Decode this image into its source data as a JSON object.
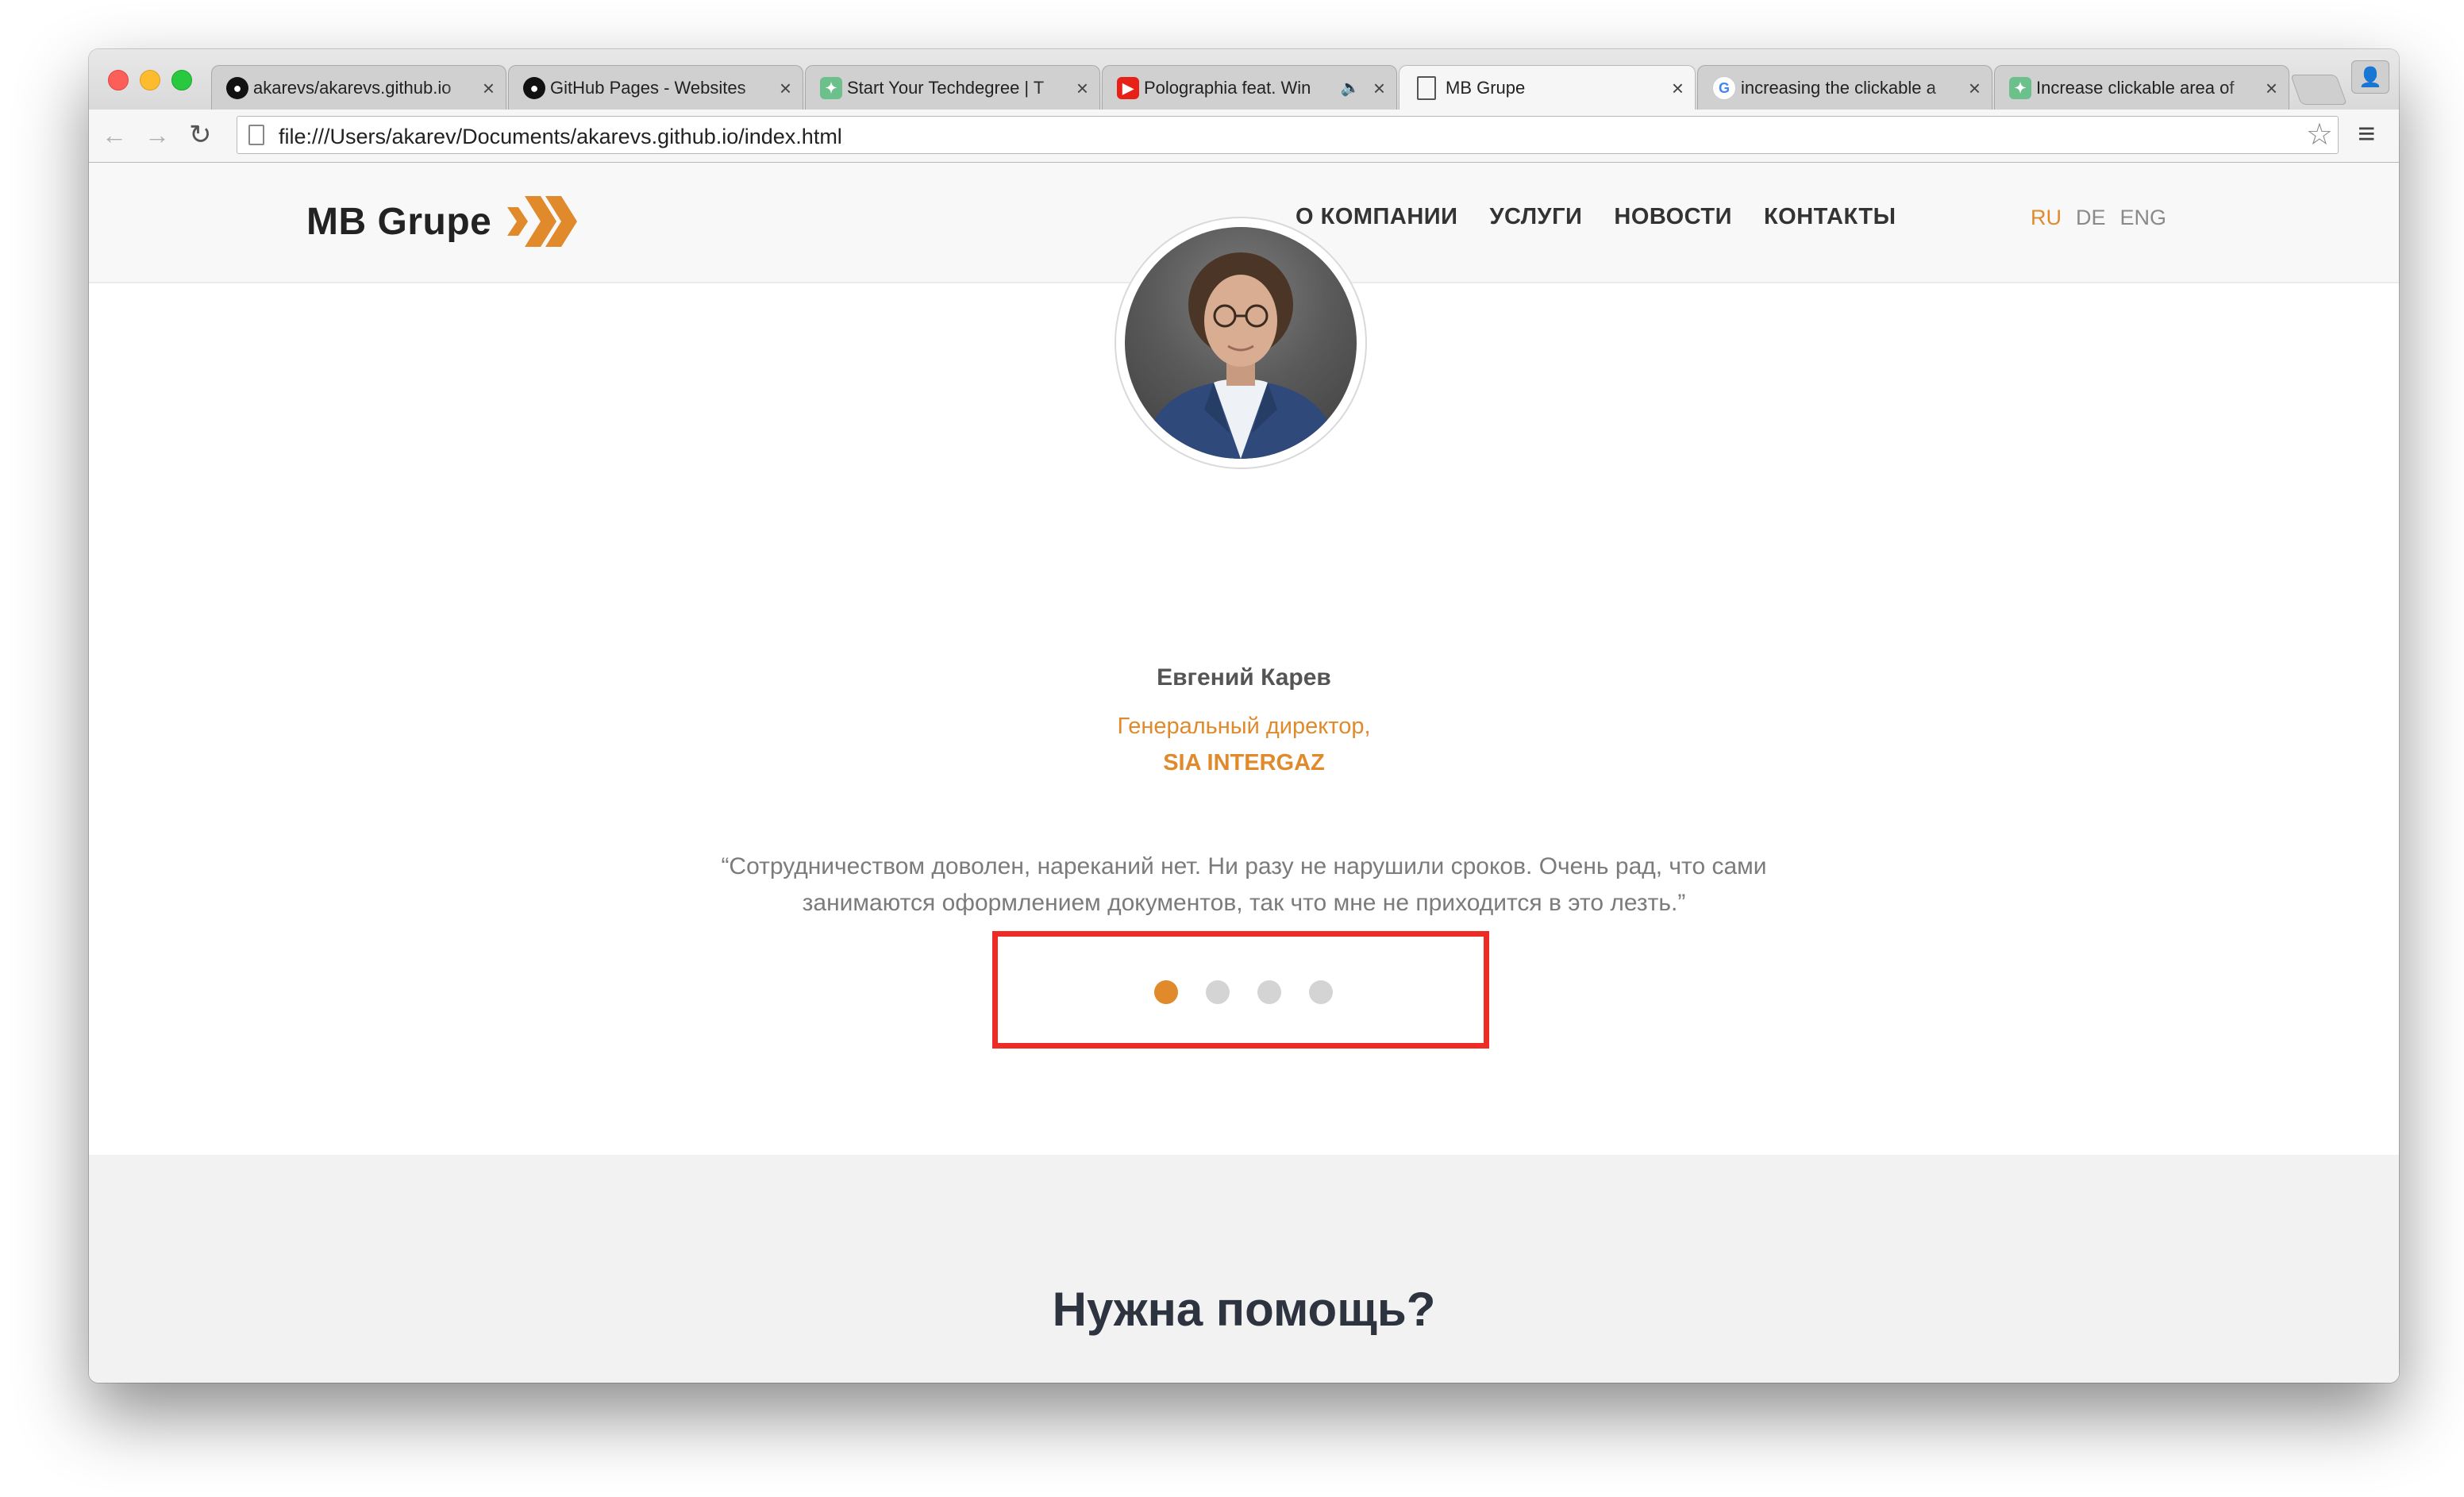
{
  "browser": {
    "tabs": [
      {
        "title": "akarevs/akarevs.github.io",
        "favicon": "github-icon"
      },
      {
        "title": "GitHub Pages - Websites",
        "favicon": "github-icon"
      },
      {
        "title": "Start Your Techdegree | T",
        "favicon": "treehouse-icon"
      },
      {
        "title": "Polographia feat. Win",
        "favicon": "youtube-icon",
        "audio": "audio-icon"
      },
      {
        "title": "MB Grupe",
        "favicon": "document-icon",
        "active": true
      },
      {
        "title": "increasing the clickable a",
        "favicon": "google-icon"
      },
      {
        "title": "Increase clickable area of",
        "favicon": "treehouse-icon"
      }
    ],
    "url": "file:///Users/akarev/Documents/akarevs.github.io/index.html",
    "close_glyph": "×"
  },
  "site": {
    "logo_text": "MB Grupe",
    "nav": [
      "О КОМПАНИИ",
      "УСЛУГИ",
      "НОВОСТИ",
      "КОНТАКТЫ"
    ],
    "languages": [
      {
        "code": "RU",
        "active": true
      },
      {
        "code": "DE",
        "active": false
      },
      {
        "code": "ENG",
        "active": false
      }
    ],
    "accent_color": "#e08a2c",
    "highlight_color": "#ef2b25"
  },
  "testimonial": {
    "name": "Евгений Карев",
    "role": "Генеральный директор,",
    "company": "SIA INTERGAZ",
    "quote_lines": [
      "“Сотрудничеством доволен, нареканий нет. Ни разу не нарушили сроков. Очень рад, что сами",
      "занимаются оформлением документов, так что мне не приходится в это лезть.”"
    ],
    "slides_total": 4,
    "active_slide": 1
  },
  "help": {
    "title": "Нужна помощь?"
  }
}
